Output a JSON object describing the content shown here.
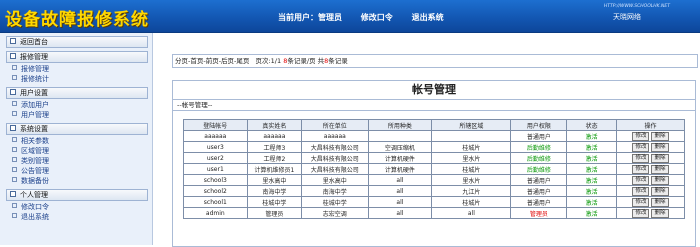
{
  "header": {
    "logo": "设备故障报修系统",
    "current_user_label": "当前用户：管理员",
    "change_password": "修改口令",
    "logout": "退出系统",
    "site_url": "HTTP://WWW.SCHOOLHK.NET",
    "brand": "天晓网络"
  },
  "sidebar": {
    "sections": [
      {
        "label": "返回首台",
        "items": []
      },
      {
        "label": "报修管理",
        "items": [
          "报修管理",
          "报修统计"
        ]
      },
      {
        "label": "用户设置",
        "items": [
          "添加用户",
          "用户管理"
        ]
      },
      {
        "label": "系统设置",
        "items": [
          "相关参数",
          "区域管理",
          "类别管理",
          "公告管理",
          "数据备份"
        ]
      },
      {
        "label": "个人管理",
        "items": [
          "修改口令",
          "退出系统"
        ]
      }
    ]
  },
  "pager": {
    "links": "分页-首页-前页-后页-尾页",
    "page_info": "页次:1/1",
    "per_page_num": "8",
    "per_page_suffix": "条记录/页",
    "total_prefix": "共",
    "total_num": "8",
    "total_suffix": "条记录"
  },
  "panel": {
    "title": "帐号管理",
    "subtitle": "--帐号管理--",
    "columns": [
      "登陆帐号",
      "真实姓名",
      "所在单位",
      "所用种类",
      "所辖区域",
      "用户权限",
      "状态",
      "操作"
    ],
    "rows": [
      {
        "account": "aaaaaa",
        "name": "aaaaaa",
        "unit": "aaaaaa",
        "type": "",
        "region": "",
        "role": "普通用户",
        "role_color": "",
        "status": "激活",
        "status_color": "green"
      },
      {
        "account": "user3",
        "name": "工程师3",
        "unit": "大昌科技有限公司",
        "type": "空调压缩机",
        "region": "桂城片",
        "role": "后勤维修",
        "role_color": "green",
        "status": "激活",
        "status_color": "green"
      },
      {
        "account": "user2",
        "name": "工程师2",
        "unit": "大昌科技有限公司",
        "type": "计算机硬件",
        "region": "里水片",
        "role": "后勤维修",
        "role_color": "green",
        "status": "激活",
        "status_color": "green"
      },
      {
        "account": "user1",
        "name": "计算机维修员1",
        "unit": "大昌科技有限公司",
        "type": "计算机硬件",
        "region": "桂城片",
        "role": "后勤维修",
        "role_color": "green",
        "status": "激活",
        "status_color": "green"
      },
      {
        "account": "school3",
        "name": "里水高中",
        "unit": "里水高中",
        "type": "all",
        "region": "里水片",
        "role": "普通用户",
        "role_color": "",
        "status": "激活",
        "status_color": "green"
      },
      {
        "account": "school2",
        "name": "南海中学",
        "unit": "南海中学",
        "type": "all",
        "region": "九江片",
        "role": "普通用户",
        "role_color": "",
        "status": "激活",
        "status_color": "green"
      },
      {
        "account": "school1",
        "name": "桂城中学",
        "unit": "桂城中学",
        "type": "all",
        "region": "桂城片",
        "role": "普通用户",
        "role_color": "",
        "status": "激活",
        "status_color": "green"
      },
      {
        "account": "admin",
        "name": "管理员",
        "unit": "志宏空调",
        "type": "all",
        "region": "all",
        "role": "管理员",
        "role_color": "red",
        "status": "激活",
        "status_color": "green"
      }
    ],
    "edit_label": "修改",
    "delete_label": "删除"
  }
}
